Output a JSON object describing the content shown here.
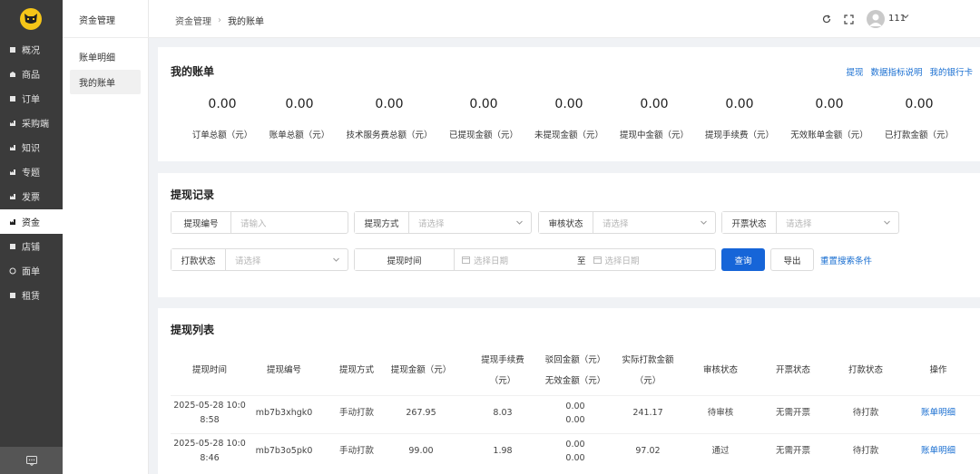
{
  "sidebar": {
    "items": [
      {
        "label": "概况",
        "icon": "overview-icon"
      },
      {
        "label": "商品",
        "icon": "goods-icon"
      },
      {
        "label": "订单",
        "icon": "order-icon"
      },
      {
        "label": "采购端",
        "icon": "purchase-icon"
      },
      {
        "label": "知识",
        "icon": "knowledge-icon"
      },
      {
        "label": "专题",
        "icon": "topic-icon"
      },
      {
        "label": "发票",
        "icon": "invoice-icon"
      },
      {
        "label": "资金",
        "icon": "funds-icon",
        "active": true
      },
      {
        "label": "店铺",
        "icon": "shop-icon"
      },
      {
        "label": "面单",
        "icon": "waybill-icon"
      },
      {
        "label": "租赁",
        "icon": "lease-icon"
      }
    ]
  },
  "subnav": {
    "title": "资金管理",
    "items": [
      {
        "label": "账单明细"
      },
      {
        "label": "我的账单",
        "active": true
      }
    ]
  },
  "header": {
    "breadcrumb": [
      "资金管理",
      "我的账单"
    ],
    "user_name": "111"
  },
  "bill": {
    "title": "我的账单",
    "links": [
      "提现",
      "数据指标说明",
      "我的银行卡"
    ],
    "stats": [
      {
        "value": "0.00",
        "label": "订单总额（元）"
      },
      {
        "value": "0.00",
        "label": "账单总额（元）"
      },
      {
        "value": "0.00",
        "label": "技术服务费总额（元）"
      },
      {
        "value": "0.00",
        "label": "已提现金额（元）"
      },
      {
        "value": "0.00",
        "label": "未提现金额（元）"
      },
      {
        "value": "0.00",
        "label": "提现中金额（元）"
      },
      {
        "value": "0.00",
        "label": "提现手续费（元）"
      },
      {
        "value": "0.00",
        "label": "无效账单金额（元）"
      },
      {
        "value": "0.00",
        "label": "已打款金额（元）"
      }
    ]
  },
  "record": {
    "title": "提现记录",
    "filters": {
      "withdraw_no": {
        "label": "提现编号",
        "placeholder": "请输入"
      },
      "withdraw_method": {
        "label": "提现方式",
        "placeholder": "请选择"
      },
      "review_status": {
        "label": "审核状态",
        "placeholder": "请选择"
      },
      "invoice_status": {
        "label": "开票状态",
        "placeholder": "请选择"
      },
      "payment_status": {
        "label": "打款状态",
        "placeholder": "请选择"
      },
      "withdraw_time": {
        "label": "提现时间",
        "start_placeholder": "选择日期",
        "separator": "至",
        "end_placeholder": "选择日期"
      }
    },
    "query_label": "查询",
    "export_label": "导出",
    "reset_label": "重置搜索条件"
  },
  "list": {
    "title": "提现列表",
    "columns": [
      {
        "line1": "提现时间"
      },
      {
        "line1": "提现编号"
      },
      {
        "line1": "提现方式"
      },
      {
        "line1": "提现金额（元）"
      },
      {
        "line1": "提现手续费",
        "line2": "（元）"
      },
      {
        "line1": "驳回金额（元）",
        "line2": "无效金额（元）"
      },
      {
        "line1": "实际打款金额",
        "line2": "（元）"
      },
      {
        "line1": "审核状态"
      },
      {
        "line1": "开票状态"
      },
      {
        "line1": "打款状态"
      },
      {
        "line1": "操作"
      }
    ],
    "rows": [
      {
        "time_1": "2025-05-28 10:0",
        "time_2": "8:58",
        "no": "mb7b3xhgk0",
        "method": "手动打款",
        "amount": "267.95",
        "fee": "8.03",
        "reject": "0.00",
        "invalid": "0.00",
        "actual": "241.17",
        "review": "待审核",
        "invoice": "无需开票",
        "payment": "待打款",
        "action": "账单明细"
      },
      {
        "time_1": "2025-05-28 10:0",
        "time_2": "8:46",
        "no": "mb7b3o5pk0",
        "method": "手动打款",
        "amount": "99.00",
        "fee": "1.98",
        "reject": "0.00",
        "invalid": "0.00",
        "actual": "97.02",
        "review": "通过",
        "invoice": "无需开票",
        "payment": "待打款",
        "action": "账单明细"
      }
    ]
  }
}
